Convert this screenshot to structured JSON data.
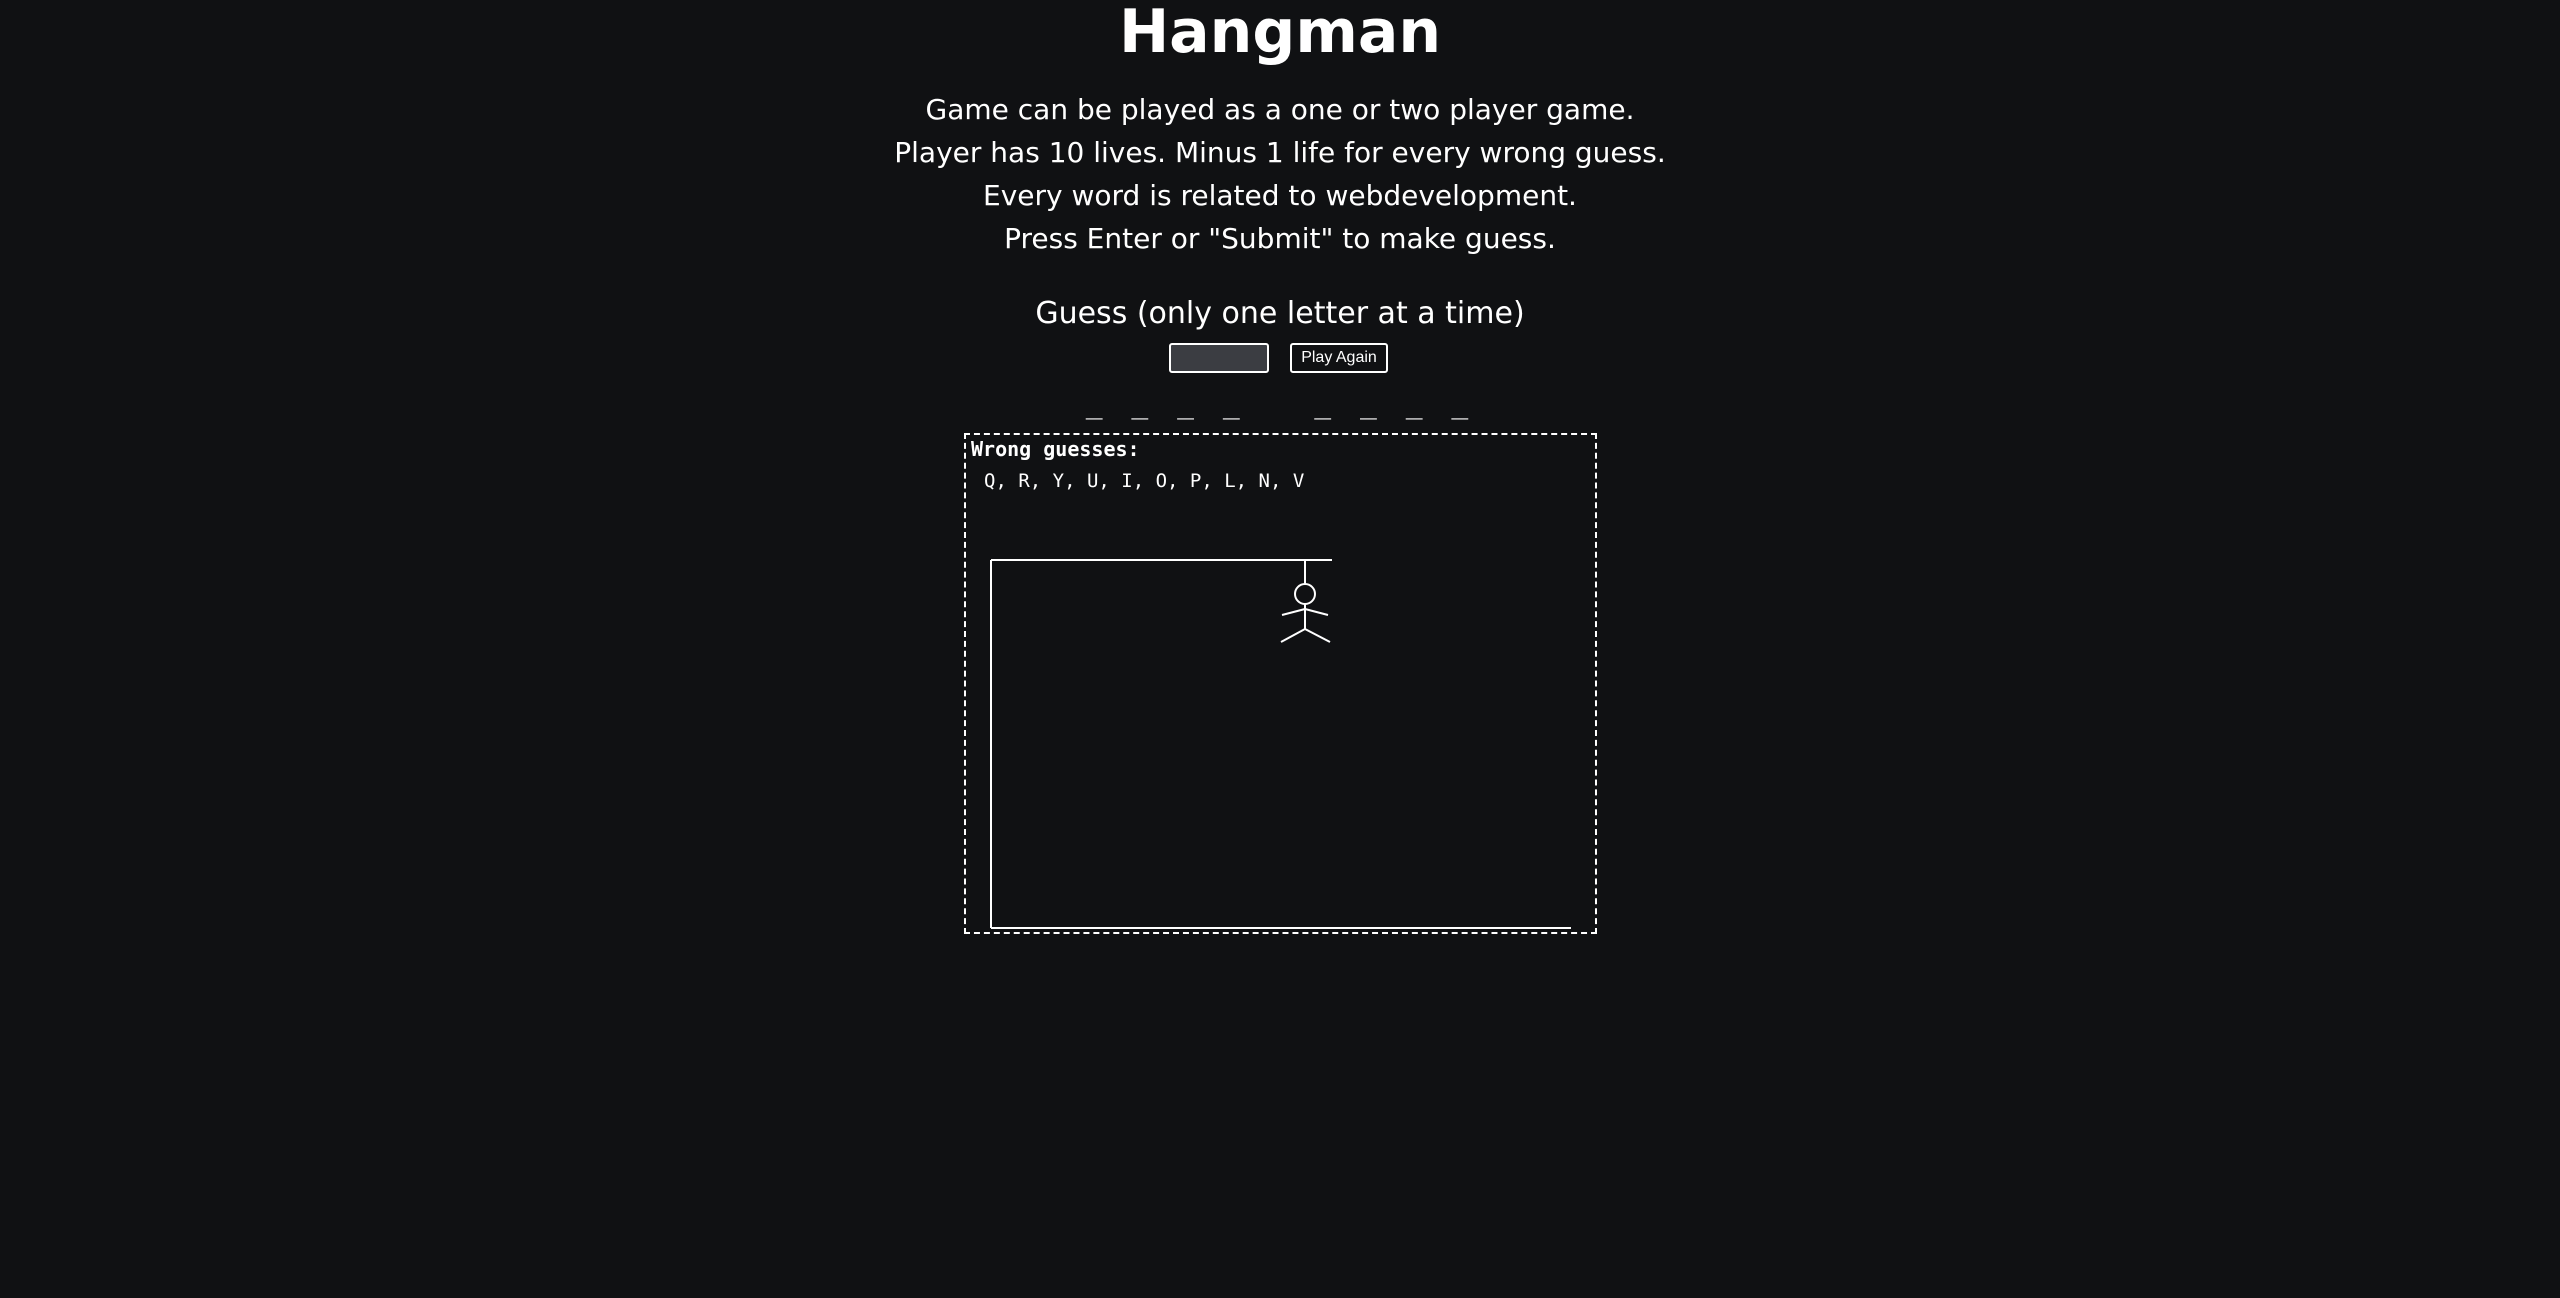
{
  "title": "Hangman",
  "rules": [
    "Game can be played as a one or two player game.",
    "Player has 10 lives. Minus 1 life for every wrong guess.",
    "Every word is related to webdevelopment.",
    "Press Enter or \"Submit\" to make guess."
  ],
  "guess": {
    "label": "Guess (only one letter at a time)",
    "value": "",
    "play_again_label": "Play Again"
  },
  "word_display": "_ _ _ _   _ _ _ _",
  "board": {
    "wrong_title": "Wrong guesses:",
    "wrong_letters": "Q, R, Y, U, I, O, P, L, N, V"
  },
  "colors": {
    "background": "#101113",
    "foreground": "#ffffff",
    "input_background": "#3b3d42"
  }
}
